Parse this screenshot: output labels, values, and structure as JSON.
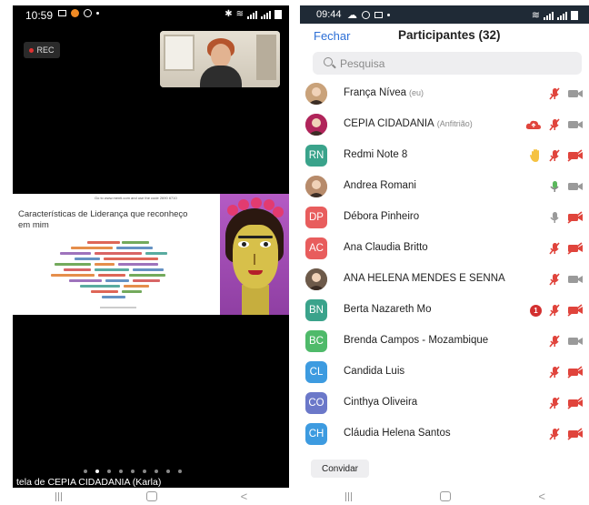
{
  "left_phone": {
    "status_time": "10:59",
    "rec_label": "REC",
    "shared_screen": {
      "top_instruction": "Go to www.menti.com and use the code 2690 6710",
      "slide_title": "Características de Liderança que reconheço em mim"
    },
    "share_caption": "tela de CEPIA CIDADANIA (Karla)"
  },
  "right_phone": {
    "status_time": "09:44",
    "header": {
      "close_label": "Fechar",
      "title": "Participantes (32)"
    },
    "search": {
      "placeholder": "Pesquisa"
    },
    "participants": [
      {
        "name": "França Nívea",
        "role": "(eu)",
        "initials": "",
        "color": "#c9a27a",
        "photo": true,
        "mic": "muted",
        "video": "on"
      },
      {
        "name": "CEPIA CIDADANIA",
        "role": "(Anfitrião)",
        "initials": "",
        "color": "#b0245a",
        "photo": true,
        "mic": "muted",
        "video": "on",
        "cloud": true
      },
      {
        "name": "Redmi Note 8",
        "role": "",
        "initials": "RN",
        "color": "#3aa38b",
        "photo": false,
        "mic": "muted",
        "video": "off",
        "hand": true
      },
      {
        "name": "Andrea Romani",
        "role": "",
        "initials": "",
        "color": "#b78b6b",
        "photo": true,
        "mic": "on",
        "video": "on"
      },
      {
        "name": "Débora Pinheiro",
        "role": "",
        "initials": "DP",
        "color": "#e85d5d",
        "photo": false,
        "mic": "idle",
        "video": "off"
      },
      {
        "name": "Ana Claudia Britto",
        "role": "",
        "initials": "AC",
        "color": "#e85d5d",
        "photo": false,
        "mic": "muted",
        "video": "off"
      },
      {
        "name": "ANA HELENA MENDES E SENNA",
        "role": "",
        "initials": "",
        "color": "#6d5a4a",
        "photo": true,
        "mic": "muted",
        "video": "on"
      },
      {
        "name": "Berta Nazareth Mo",
        "role": "",
        "initials": "BN",
        "color": "#3aa38b",
        "photo": false,
        "mic": "muted",
        "video": "off",
        "badge": "1"
      },
      {
        "name": "Brenda Campos - Mozambique",
        "role": "",
        "initials": "BC",
        "color": "#4fba6a",
        "photo": false,
        "mic": "muted",
        "video": "on"
      },
      {
        "name": "Candida Luis",
        "role": "",
        "initials": "CL",
        "color": "#3d9be0",
        "photo": false,
        "mic": "muted",
        "video": "off"
      },
      {
        "name": "Cinthya Oliveira",
        "role": "",
        "initials": "CO",
        "color": "#6b78c9",
        "photo": false,
        "mic": "muted",
        "video": "off"
      },
      {
        "name": "Cláudia Helena Santos",
        "role": "",
        "initials": "CH",
        "color": "#3d9be0",
        "photo": false,
        "mic": "muted",
        "video": "off"
      }
    ],
    "invite_label": "Convidar"
  },
  "colors": {
    "accent_blue": "#2d6fd6",
    "muted_red": "#e0443c",
    "mic_on_green": "#5bb85d"
  }
}
